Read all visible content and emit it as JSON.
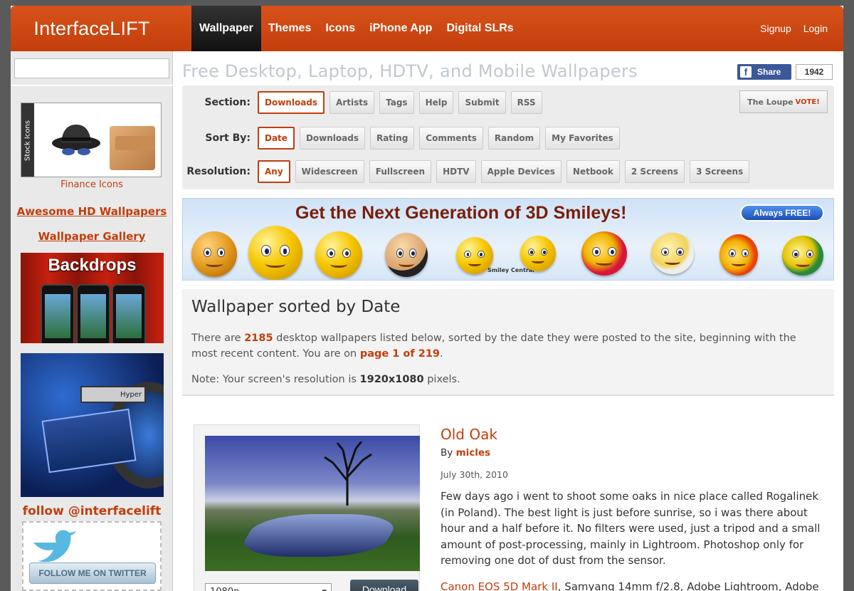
{
  "header": {
    "logo": "InterfaceLIFT",
    "nav": [
      "Wallpaper",
      "Themes",
      "Icons",
      "iPhone App",
      "Digital SLRs"
    ],
    "signup": "Signup",
    "login": "Login"
  },
  "sidebar": {
    "search_value": "",
    "stock_icons_tab": "Stock Icons",
    "finance_label": "Finance Icons",
    "link_awesome": "Awesome HD Wallpapers",
    "link_gallery": "Wallpaper Gallery",
    "backdrops_title": "Backdrops",
    "hyper_label": "Hyper",
    "follow": "follow @interfacelift",
    "twitter_button": "FOLLOW ME ON TWITTER"
  },
  "main": {
    "page_title": "Free Desktop, Laptop, HDTV, and Mobile Wallpapers",
    "fb_share": "Share",
    "fb_count": "1942",
    "section_label": "Section:",
    "section_items": [
      "Downloads",
      "Artists",
      "Tags",
      "Help",
      "Submit",
      "RSS"
    ],
    "loupe": "The Loupe",
    "loupe_vote": "VOTE!",
    "sort_label": "Sort By:",
    "sort_items": [
      "Date",
      "Downloads",
      "Rating",
      "Comments",
      "Random",
      "My Favorites"
    ],
    "resolution_label": "Resolution:",
    "resolution_items": [
      "Any",
      "Widescreen",
      "Fullscreen",
      "HDTV",
      "Apple Devices",
      "Netbook",
      "2 Screens",
      "3 Screens"
    ],
    "banner_title": "Get the Next Generation of 3D Smileys!",
    "banner_badge": "Always FREE!",
    "banner_brand": "Smiley Central",
    "intro_heading": "Wallpaper sorted by Date",
    "intro_p1_a": "There are ",
    "intro_count": "2185",
    "intro_p1_b": " desktop wallpapers listed below, sorted by the date they were posted to the site, beginning with the most recent content. You are on ",
    "intro_page": "page 1 of 219",
    "intro_p1_c": ".",
    "intro_p2_a": "Note: Your screen's resolution is ",
    "intro_res": "1920x1080",
    "intro_p2_b": " pixels."
  },
  "wallpaper": {
    "title": "Old Oak",
    "by": "By",
    "author": "micles",
    "date": "July 30th, 2010",
    "description": "Few days ago i went to shoot some oaks in nice place called Rogalinek (in Poland). The best light is just before sunrise, so i was there about hour and a half before it. No filters were used, just a tripod and a small amount of post-processing, mainly in Lightroom. Photoshop only for removing one dot of dust from the sensor.",
    "camera": "Canon EOS 5D Mark II",
    "gear_rest": ", Samyang 14mm f/2.8, Adobe Lightroom, Adobe",
    "resolution_select": "1080p",
    "download": "Download"
  }
}
